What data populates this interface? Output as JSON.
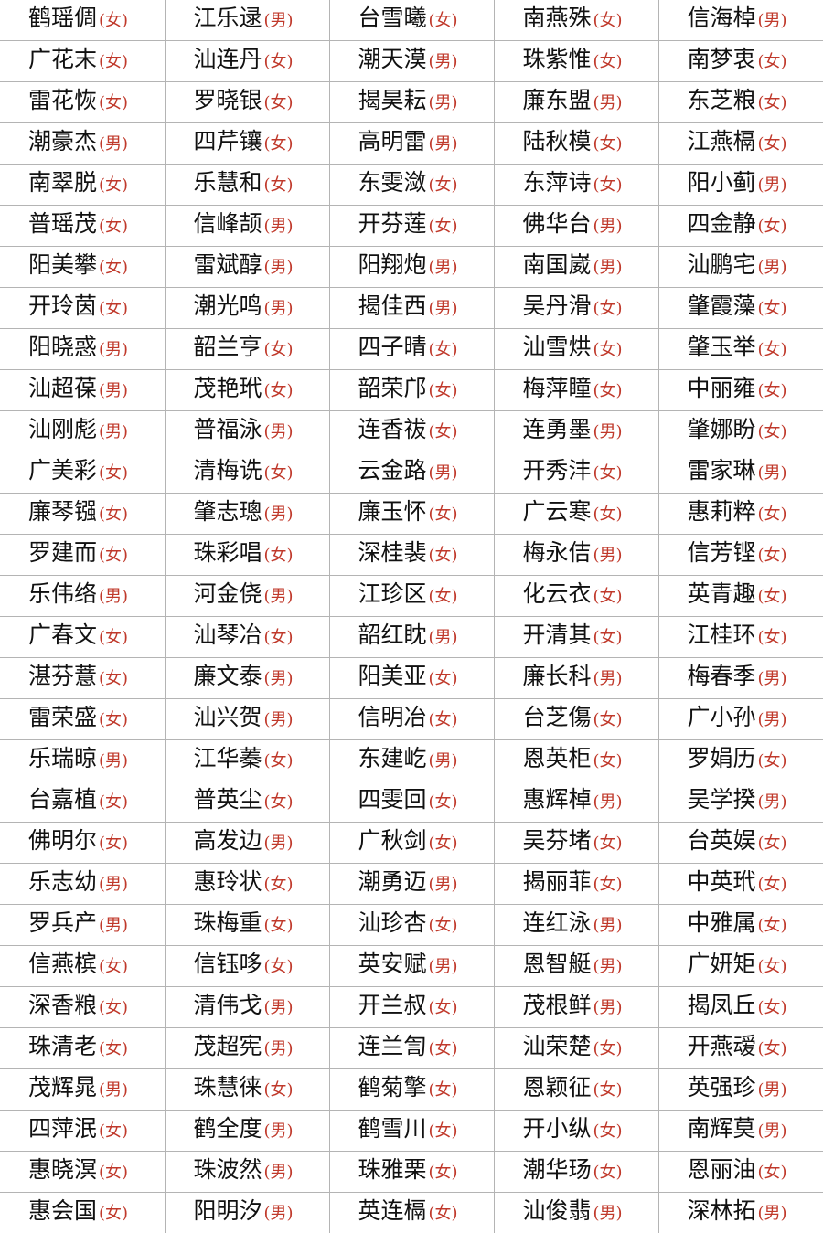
{
  "rows": [
    [
      [
        "鹤瑶倜",
        "(女)"
      ],
      [
        "江乐逯",
        "(男)"
      ],
      [
        "台雪曦",
        "(女)"
      ],
      [
        "南燕殊",
        "(女)"
      ],
      [
        "信海棹",
        "(男)"
      ]
    ],
    [
      [
        "广花末",
        "(女)"
      ],
      [
        "汕连丹",
        "(女)"
      ],
      [
        "潮天漠",
        "(男)"
      ],
      [
        "珠紫惟",
        "(女)"
      ],
      [
        "南梦衷",
        "(女)"
      ]
    ],
    [
      [
        "雷花恢",
        "(女)"
      ],
      [
        "罗晓银",
        "(女)"
      ],
      [
        "揭昊耘",
        "(男)"
      ],
      [
        "廉东盟",
        "(男)"
      ],
      [
        "东芝粮",
        "(女)"
      ]
    ],
    [
      [
        "潮豪杰",
        "(男)"
      ],
      [
        "四芹镶",
        "(女)"
      ],
      [
        "高明雷",
        "(男)"
      ],
      [
        "陆秋模",
        "(女)"
      ],
      [
        "江燕槅",
        "(女)"
      ]
    ],
    [
      [
        "南翠脱",
        "(女)"
      ],
      [
        "乐慧和",
        "(女)"
      ],
      [
        "东雯潋",
        "(女)"
      ],
      [
        "东萍诗",
        "(女)"
      ],
      [
        "阳小蓟",
        "(男)"
      ]
    ],
    [
      [
        "普瑶茂",
        "(女)"
      ],
      [
        "信峰颉",
        "(男)"
      ],
      [
        "开芬莲",
        "(女)"
      ],
      [
        "佛华台",
        "(男)"
      ],
      [
        "四金静",
        "(女)"
      ]
    ],
    [
      [
        "阳美攀",
        "(女)"
      ],
      [
        "雷斌醇",
        "(男)"
      ],
      [
        "阳翔炮",
        "(男)"
      ],
      [
        "南国崴",
        "(男)"
      ],
      [
        "汕鹏宅",
        "(男)"
      ]
    ],
    [
      [
        "开玲茵",
        "(女)"
      ],
      [
        "潮光鸣",
        "(男)"
      ],
      [
        "揭佳西",
        "(男)"
      ],
      [
        "吴丹滑",
        "(女)"
      ],
      [
        "肇霞藻",
        "(女)"
      ]
    ],
    [
      [
        "阳晓惑",
        "(男)"
      ],
      [
        "韶兰亨",
        "(女)"
      ],
      [
        "四子晴",
        "(女)"
      ],
      [
        "汕雪烘",
        "(女)"
      ],
      [
        "肇玉举",
        "(女)"
      ]
    ],
    [
      [
        "汕超葆",
        "(男)"
      ],
      [
        "茂艳玳",
        "(女)"
      ],
      [
        "韶荣邝",
        "(女)"
      ],
      [
        "梅萍瞳",
        "(女)"
      ],
      [
        "中丽雍",
        "(女)"
      ]
    ],
    [
      [
        "汕刚彪",
        "(男)"
      ],
      [
        "普福泳",
        "(男)"
      ],
      [
        "连香祓",
        "(女)"
      ],
      [
        "连勇墨",
        "(男)"
      ],
      [
        "肇娜盼",
        "(女)"
      ]
    ],
    [
      [
        "广美彩",
        "(女)"
      ],
      [
        "清梅诜",
        "(女)"
      ],
      [
        "云金路",
        "(男)"
      ],
      [
        "开秀沣",
        "(女)"
      ],
      [
        "雷家琳",
        "(男)"
      ]
    ],
    [
      [
        "廉琴镪",
        "(女)"
      ],
      [
        "肇志璁",
        "(男)"
      ],
      [
        "廉玉怀",
        "(女)"
      ],
      [
        "广云寒",
        "(女)"
      ],
      [
        "惠莉粹",
        "(女)"
      ]
    ],
    [
      [
        "罗建而",
        "(女)"
      ],
      [
        "珠彩唱",
        "(女)"
      ],
      [
        "深桂裴",
        "(女)"
      ],
      [
        "梅永佶",
        "(男)"
      ],
      [
        "信芳铿",
        "(女)"
      ]
    ],
    [
      [
        "乐伟络",
        "(男)"
      ],
      [
        "河金侥",
        "(男)"
      ],
      [
        "江珍区",
        "(女)"
      ],
      [
        "化云衣",
        "(女)"
      ],
      [
        "英青趣",
        "(女)"
      ]
    ],
    [
      [
        "广春文",
        "(女)"
      ],
      [
        "汕琴冶",
        "(女)"
      ],
      [
        "韶红眈",
        "(男)"
      ],
      [
        "开清其",
        "(女)"
      ],
      [
        "江桂环",
        "(女)"
      ]
    ],
    [
      [
        "湛芬薏",
        "(女)"
      ],
      [
        "廉文泰",
        "(男)"
      ],
      [
        "阳美亚",
        "(女)"
      ],
      [
        "廉长科",
        "(男)"
      ],
      [
        "梅春季",
        "(男)"
      ]
    ],
    [
      [
        "雷荣盛",
        "(女)"
      ],
      [
        "汕兴贺",
        "(男)"
      ],
      [
        "信明冶",
        "(女)"
      ],
      [
        "台芝傷",
        "(女)"
      ],
      [
        "广小孙",
        "(男)"
      ]
    ],
    [
      [
        "乐瑞晾",
        "(男)"
      ],
      [
        "江华蓁",
        "(女)"
      ],
      [
        "东建屹",
        "(男)"
      ],
      [
        "恩英柜",
        "(女)"
      ],
      [
        "罗娟历",
        "(女)"
      ]
    ],
    [
      [
        "台嘉植",
        "(女)"
      ],
      [
        "普英尘",
        "(女)"
      ],
      [
        "四雯回",
        "(女)"
      ],
      [
        "惠辉棹",
        "(男)"
      ],
      [
        "吴学揆",
        "(男)"
      ]
    ],
    [
      [
        "佛明尔",
        "(女)"
      ],
      [
        "高发边",
        "(男)"
      ],
      [
        "广秋剑",
        "(女)"
      ],
      [
        "吴芬堵",
        "(女)"
      ],
      [
        "台英娱",
        "(女)"
      ]
    ],
    [
      [
        "乐志幼",
        "(男)"
      ],
      [
        "惠玲状",
        "(女)"
      ],
      [
        "潮勇迈",
        "(男)"
      ],
      [
        "揭丽菲",
        "(女)"
      ],
      [
        "中英玳",
        "(女)"
      ]
    ],
    [
      [
        "罗兵产",
        "(男)"
      ],
      [
        "珠梅重",
        "(女)"
      ],
      [
        "汕珍杏",
        "(女)"
      ],
      [
        "连红泳",
        "(男)"
      ],
      [
        "中雅属",
        "(女)"
      ]
    ],
    [
      [
        "信燕槟",
        "(女)"
      ],
      [
        "信钰哆",
        "(女)"
      ],
      [
        "英安赋",
        "(男)"
      ],
      [
        "恩智艇",
        "(男)"
      ],
      [
        "广妍矩",
        "(女)"
      ]
    ],
    [
      [
        "深香粮",
        "(女)"
      ],
      [
        "清伟戈",
        "(男)"
      ],
      [
        "开兰叔",
        "(女)"
      ],
      [
        "茂根鲜",
        "(男)"
      ],
      [
        "揭凤丘",
        "(女)"
      ]
    ],
    [
      [
        "珠清老",
        "(女)"
      ],
      [
        "茂超宪",
        "(男)"
      ],
      [
        "连兰訇",
        "(女)"
      ],
      [
        "汕荣楚",
        "(女)"
      ],
      [
        "开燕叆",
        "(女)"
      ]
    ],
    [
      [
        "茂辉晁",
        "(男)"
      ],
      [
        "珠慧徕",
        "(女)"
      ],
      [
        "鹤菊擎",
        "(女)"
      ],
      [
        "恩颖征",
        "(女)"
      ],
      [
        "英强珍",
        "(男)"
      ]
    ],
    [
      [
        "四萍泯",
        "(女)"
      ],
      [
        "鹤全度",
        "(男)"
      ],
      [
        "鹤雪川",
        "(女)"
      ],
      [
        "开小纵",
        "(女)"
      ],
      [
        "南辉莫",
        "(男)"
      ]
    ],
    [
      [
        "惠晓溟",
        "(女)"
      ],
      [
        "珠波然",
        "(男)"
      ],
      [
        "珠雅栗",
        "(女)"
      ],
      [
        "潮华玚",
        "(女)"
      ],
      [
        "恩丽油",
        "(女)"
      ]
    ],
    [
      [
        "惠会国",
        "(女)"
      ],
      [
        "阳明汐",
        "(男)"
      ],
      [
        "英连槅",
        "(女)"
      ],
      [
        "汕俊翡",
        "(男)"
      ],
      [
        "深林拓",
        "(男)"
      ]
    ]
  ],
  "colors": {
    "name": "#111111",
    "gender": "#c0392b",
    "grid": "#b4b4b4",
    "background": "#ffffff"
  }
}
